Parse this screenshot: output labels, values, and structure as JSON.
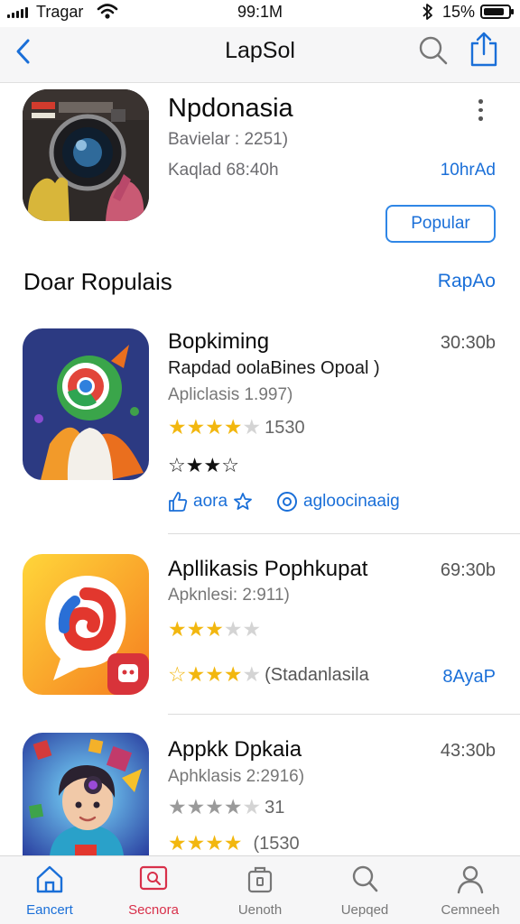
{
  "status_bar": {
    "carrier": "Tragar",
    "time": "99:1M",
    "battery_percent": "15%",
    "battery_level": 0.85
  },
  "nav": {
    "title": "LapSol"
  },
  "featured": {
    "name": "Npdonasia",
    "subtitle": "Bavielar : 2251)",
    "meta": "Kaqlad 68:40h",
    "link": "10hrAd",
    "button": "Popular"
  },
  "section": {
    "title": "Doar Ropulais",
    "link": "RapAo"
  },
  "apps": [
    {
      "name": "Bopkiming",
      "size": "30:30b",
      "desc": "Rapdad oolaBines Opoal )",
      "category": "Apliclasis 1.997)",
      "rating_count": "1530",
      "action_left": "aora",
      "action_right": "agloocinaaig"
    },
    {
      "name": "Apllikasis Pophkupat",
      "size": "69:30b",
      "category": "Apknlesi: 2:911)",
      "review_label": "(Stadanlasila",
      "link": "8AyaP"
    },
    {
      "name": "Appkk Dpkaia",
      "size": "43:30b",
      "category": "Aphklasis 2:2916)",
      "rating_count": "31",
      "rating_count_2": "(1530"
    }
  ],
  "tabs": [
    {
      "label": "Eancert",
      "icon": "home-icon"
    },
    {
      "label": "Secnora",
      "icon": "search-card-icon"
    },
    {
      "label": "Uenoth",
      "icon": "bag-icon"
    },
    {
      "label": "Uepqed",
      "icon": "search-icon"
    },
    {
      "label": "Cemneeh",
      "icon": "person-icon"
    }
  ],
  "colors": {
    "accent": "#1a6fd8",
    "star": "#f2b70f",
    "secondary_tab": "#d8304a"
  }
}
